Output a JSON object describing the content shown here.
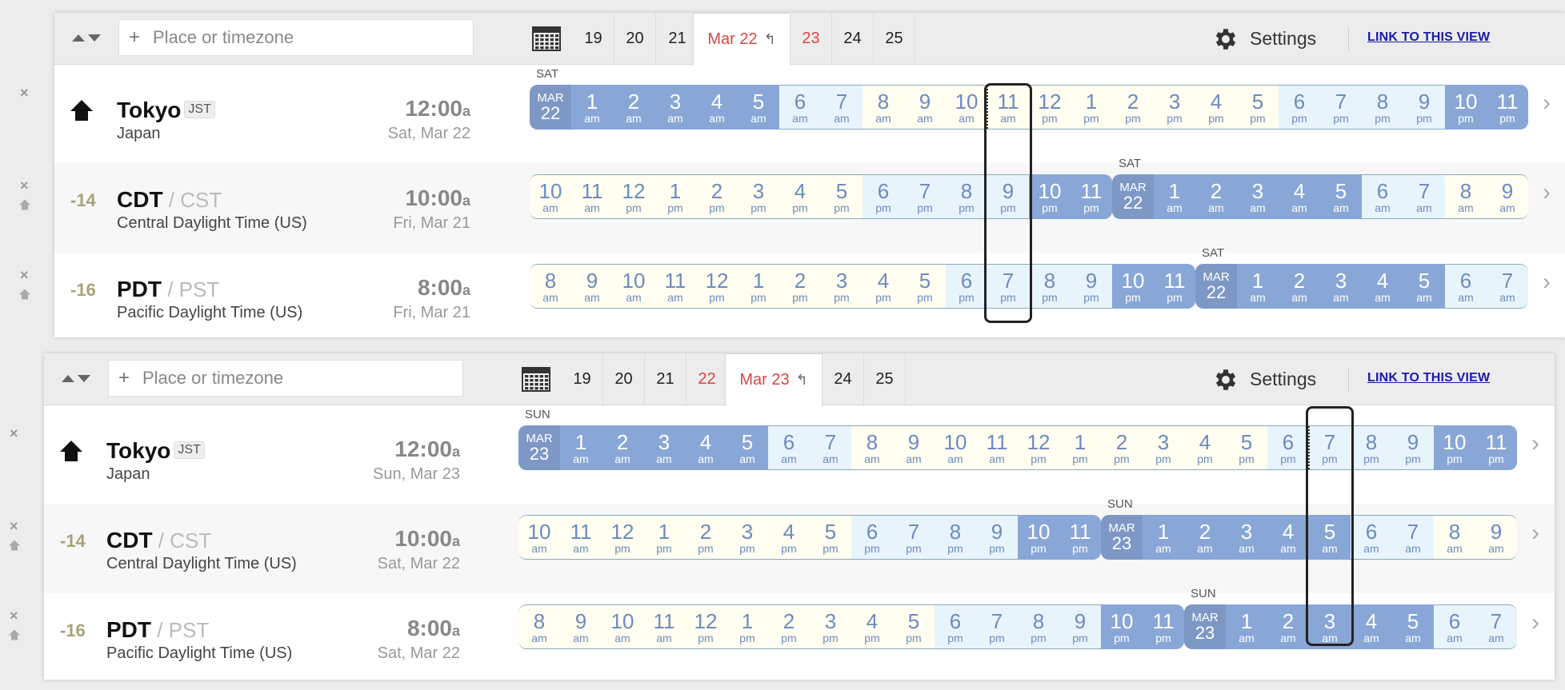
{
  "panels": [
    {
      "search": {
        "placeholder": "Place or timezone"
      },
      "date_tabs": [
        {
          "label": "19",
          "style": "normal"
        },
        {
          "label": "20",
          "style": "normal"
        },
        {
          "label": "21",
          "style": "normal"
        },
        {
          "label": "Mar 22",
          "style": "active"
        },
        {
          "label": "23",
          "style": "red"
        },
        {
          "label": "24",
          "style": "normal"
        },
        {
          "label": "25",
          "style": "normal"
        }
      ],
      "settings_label": "Settings",
      "link_label": "LINK TO THIS VIEW",
      "rows": [
        {
          "kind": "home",
          "name": "Tokyo",
          "abbr": "JST",
          "sub": "Japan",
          "time": "12:00",
          "ampm": "a",
          "date": "Sat, Mar 22",
          "offset": "",
          "day_label": "SAT"
        },
        {
          "kind": "other",
          "name": "CDT",
          "alt": "CST",
          "sub": "Central Daylight Time (US)",
          "time": "10:00",
          "ampm": "a",
          "date": "Fri, Mar 21",
          "offset": "-14",
          "day_label": "SAT"
        },
        {
          "kind": "other",
          "name": "PDT",
          "alt": "PST",
          "sub": "Pacific Daylight Time (US)",
          "time": "8:00",
          "ampm": "a",
          "date": "Fri, Mar 21",
          "offset": "-16",
          "day_label": "SAT"
        }
      ]
    },
    {
      "search": {
        "placeholder": "Place or timezone"
      },
      "date_tabs": [
        {
          "label": "19",
          "style": "normal"
        },
        {
          "label": "20",
          "style": "normal"
        },
        {
          "label": "21",
          "style": "normal"
        },
        {
          "label": "22",
          "style": "red"
        },
        {
          "label": "Mar 23",
          "style": "active"
        },
        {
          "label": "24",
          "style": "normal"
        },
        {
          "label": "25",
          "style": "normal"
        }
      ],
      "settings_label": "Settings",
      "link_label": "LINK TO THIS VIEW",
      "rows": [
        {
          "kind": "home",
          "name": "Tokyo",
          "abbr": "JST",
          "sub": "Japan",
          "time": "12:00",
          "ampm": "a",
          "date": "Sun, Mar 23",
          "offset": "",
          "day_label": "SUN"
        },
        {
          "kind": "other",
          "name": "CDT",
          "alt": "CST",
          "sub": "Central Daylight Time (US)",
          "time": "10:00",
          "ampm": "a",
          "date": "Sat, Mar 22",
          "offset": "-14",
          "day_label": "SUN"
        },
        {
          "kind": "other",
          "name": "PDT",
          "alt": "PST",
          "sub": "Pacific Daylight Time (US)",
          "time": "8:00",
          "ampm": "a",
          "date": "Sat, Mar 22",
          "offset": "-16",
          "day_label": "SUN"
        }
      ]
    }
  ],
  "strips": [
    [
      [
        "MAR|22",
        "1",
        "2",
        "3",
        "4",
        "5",
        "6",
        "7",
        "8",
        "9",
        "10",
        "11",
        "12",
        "1",
        "2",
        "3",
        "4",
        "5",
        "6",
        "7",
        "8",
        "9",
        "10",
        "11"
      ],
      [
        "10",
        "11",
        "12",
        "1",
        "2",
        "3",
        "4",
        "5",
        "6",
        "7",
        "8",
        "9",
        "10",
        "11",
        "MAR|22",
        "1",
        "2",
        "3",
        "4",
        "5",
        "6",
        "7",
        "8",
        "9"
      ],
      [
        "8",
        "9",
        "10",
        "11",
        "12",
        "1",
        "2",
        "3",
        "4",
        "5",
        "6",
        "7",
        "8",
        "9",
        "10",
        "11",
        "MAR|22",
        "1",
        "2",
        "3",
        "4",
        "5",
        "6",
        "7"
      ]
    ],
    [
      [
        "MAR|23",
        "1",
        "2",
        "3",
        "4",
        "5",
        "6",
        "7",
        "8",
        "9",
        "10",
        "11",
        "12",
        "1",
        "2",
        "3",
        "4",
        "5",
        "6",
        "7",
        "8",
        "9",
        "10",
        "11"
      ],
      [
        "10",
        "11",
        "12",
        "1",
        "2",
        "3",
        "4",
        "5",
        "6",
        "7",
        "8",
        "9",
        "10",
        "11",
        "MAR|23",
        "1",
        "2",
        "3",
        "4",
        "5",
        "6",
        "7",
        "8",
        "9"
      ],
      [
        "8",
        "9",
        "10",
        "11",
        "12",
        "1",
        "2",
        "3",
        "4",
        "5",
        "6",
        "7",
        "8",
        "9",
        "10",
        "11",
        "MAR|23",
        "1",
        "2",
        "3",
        "4",
        "5",
        "6",
        "7"
      ]
    ]
  ],
  "strip_ampm": [
    [
      [
        "",
        "am",
        "am",
        "am",
        "am",
        "am",
        "am",
        "am",
        "am",
        "am",
        "am",
        "am",
        "pm",
        "pm",
        "pm",
        "pm",
        "pm",
        "pm",
        "pm",
        "pm",
        "pm",
        "pm",
        "pm",
        "pm"
      ],
      [
        "am",
        "am",
        "pm",
        "pm",
        "pm",
        "pm",
        "pm",
        "pm",
        "pm",
        "pm",
        "pm",
        "pm",
        "pm",
        "pm",
        "",
        "am",
        "am",
        "am",
        "am",
        "am",
        "am",
        "am",
        "am",
        "am"
      ],
      [
        "am",
        "am",
        "am",
        "am",
        "pm",
        "pm",
        "pm",
        "pm",
        "pm",
        "pm",
        "pm",
        "pm",
        "pm",
        "pm",
        "pm",
        "pm",
        "",
        "am",
        "am",
        "am",
        "am",
        "am",
        "am",
        "am"
      ]
    ],
    [
      [
        "",
        "am",
        "am",
        "am",
        "am",
        "am",
        "am",
        "am",
        "am",
        "am",
        "am",
        "am",
        "pm",
        "pm",
        "pm",
        "pm",
        "pm",
        "pm",
        "pm",
        "pm",
        "pm",
        "pm",
        "pm",
        "pm"
      ],
      [
        "am",
        "am",
        "pm",
        "pm",
        "pm",
        "pm",
        "pm",
        "pm",
        "pm",
        "pm",
        "pm",
        "pm",
        "pm",
        "pm",
        "",
        "am",
        "am",
        "am",
        "am",
        "am",
        "am",
        "am",
        "am",
        "am"
      ],
      [
        "am",
        "am",
        "am",
        "am",
        "pm",
        "pm",
        "pm",
        "pm",
        "pm",
        "pm",
        "pm",
        "pm",
        "pm",
        "pm",
        "pm",
        "pm",
        "",
        "am",
        "am",
        "am",
        "am",
        "am",
        "am",
        "am"
      ]
    ]
  ],
  "colors": {
    "night": "#89a7d6",
    "dusk": "#e8f4fb",
    "day": "#fffef0",
    "accent_red": "#dd4444",
    "link": "#1a1aa8"
  },
  "icons": [
    "sort-arrows-icon",
    "plus-icon",
    "calendar-icon",
    "gear-icon",
    "home-icon",
    "close-icon",
    "chevron-right-icon"
  ]
}
